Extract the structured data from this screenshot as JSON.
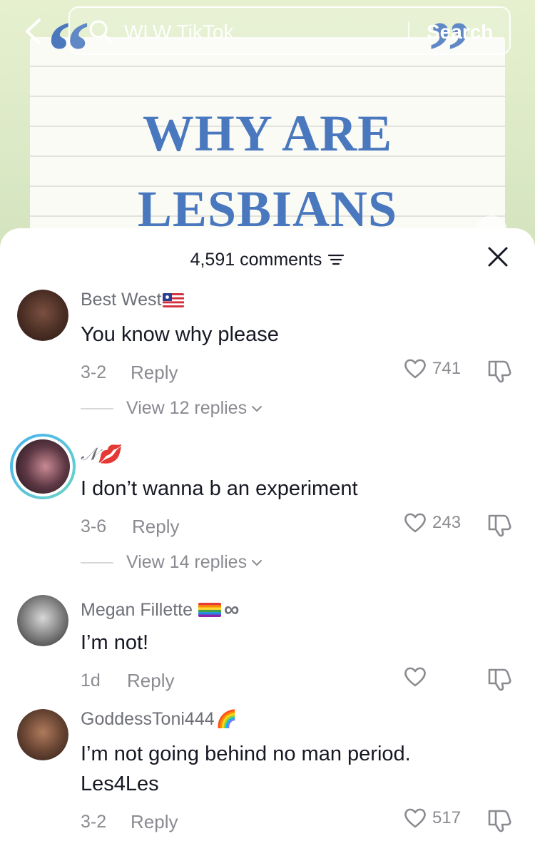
{
  "search": {
    "query": "WLW TikTok",
    "button_label": "Search"
  },
  "video": {
    "headline_line1": "WHY ARE",
    "headline_line2": "LESBIANS"
  },
  "comments_sheet": {
    "count_label": "4,591 comments",
    "comments": [
      {
        "username": "Best West",
        "text": "You know why please",
        "date": "3-2",
        "reply_label": "Reply",
        "likes": "741",
        "view_replies": "View 12 replies",
        "badge": "flag-icon"
      },
      {
        "username": "𝒩💋",
        "text": "I don’t wanna b an experiment",
        "date": "3-6",
        "reply_label": "Reply",
        "likes": "243",
        "view_replies": "View 14 replies"
      },
      {
        "username": "Megan Fillette",
        "username_suffix": "∞",
        "text": "I’m not!",
        "date": "1d",
        "reply_label": "Reply",
        "likes": "",
        "badge": "pride-flag-icon"
      },
      {
        "username": "GoddessToni444",
        "username_suffix": "🌈",
        "text": "I’m not going behind no man period. Les4Les",
        "date": "3-2",
        "reply_label": "Reply",
        "likes": "517"
      }
    ]
  },
  "colors": {
    "headline": "#4a78be",
    "text_primary": "#161823",
    "text_secondary": "#8a8b91",
    "story_ring_start": "#49b1ee",
    "story_ring_end": "#6bd5c8"
  }
}
